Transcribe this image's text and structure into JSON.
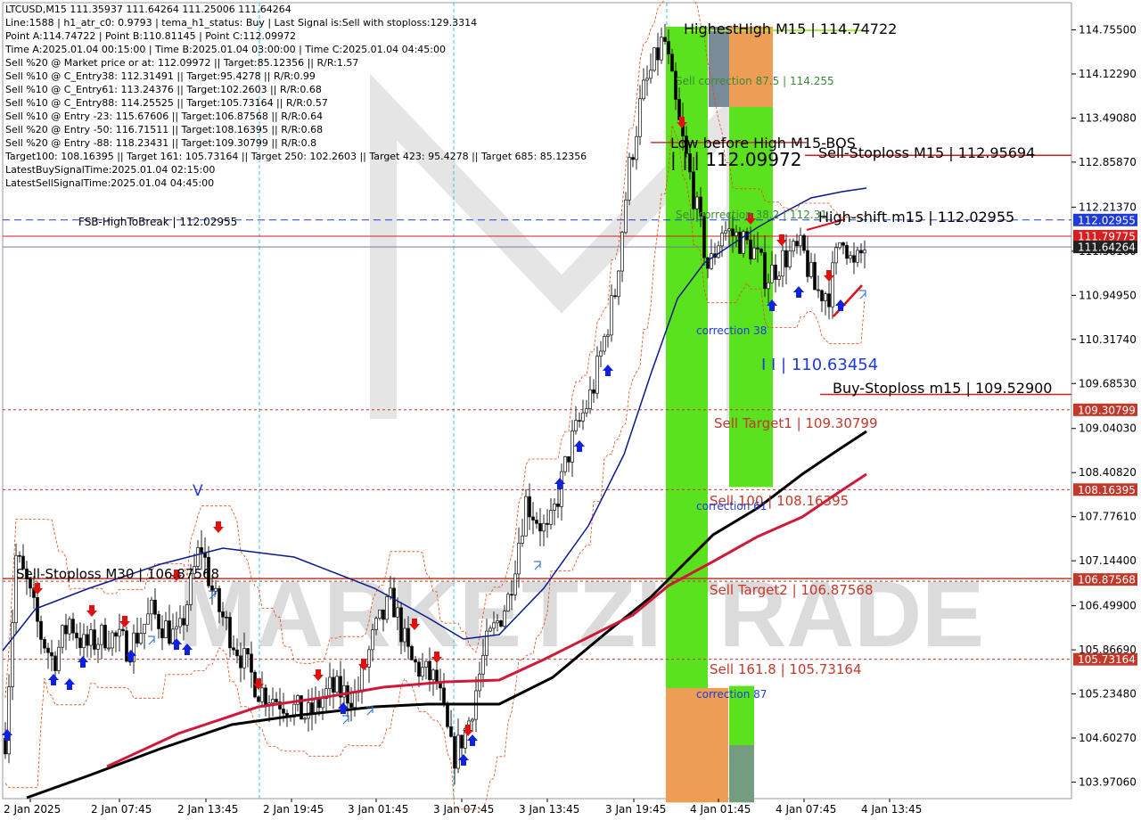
{
  "chart_data": {
    "type": "candlestick",
    "symbol": "LTCUSD,M15",
    "header": "LTCUSD,M15  111.35937 111.64264 111.25006 111.64264",
    "info_lines": [
      "Line:1588 | h1_atr_c0: 0.9793 | tema_h1_status: Buy | Last Signal is:Sell with stoploss:129.3314",
      "Point A:114.74722 | Point B:110.81145 | Point C:112.09972",
      "Time A:2025.01.04 00:15:00 | Time B:2025.01.04 03:00:00 | Time C:2025.01.04 04:45:00",
      "Sell %20 @ Market price or at: 112.09972 || Target:85.12356 || R/R:1.57",
      "Sell %10 @ C_Entry38: 112.31491 || Target:95.4278 || R/R:0.99",
      "Sell %10 @ C_Entry61: 113.24376 || Target:102.2603 || R/R:0.68",
      "Sell %10 @ C_Entry88: 114.25525 || Target:105.73164 || R/R:0.57",
      "Sell %10 @ Entry -23: 115.67606 || Target:106.87568 || R/R:0.64",
      "Sell %20 @ Entry -50: 116.71511 || Target:108.16395 || R/R:0.68",
      "Sell %20 @ Entry -88: 118.23431 || Target:109.30799 || R/R:0.8",
      "Target100: 108.16395 || Target 161: 105.73164 || Target 250: 102.2603 || Target 423: 95.4278 || Target 685: 85.12356",
      "LatestBuySignalTime:2025.01.04 02:15:00",
      "LatestSellSignalTime:2025.01.04 04:45:00"
    ],
    "y_ticks": [
      "114.75500",
      "114.12290",
      "113.49080",
      "112.85870",
      "112.21370",
      "111.58160",
      "110.94950",
      "110.31740",
      "109.68530",
      "109.04030",
      "108.40820",
      "107.77610",
      "107.14400",
      "106.49900",
      "105.86690",
      "105.23480",
      "104.60270",
      "103.97060"
    ],
    "x_ticks": [
      "2 Jan 2025",
      "2 Jan 07:45",
      "2 Jan 13:45",
      "2 Jan 19:45",
      "3 Jan 01:45",
      "3 Jan 07:45",
      "3 Jan 13:45",
      "3 Jan 19:45",
      "4 Jan 01:45",
      "4 Jan 07:45",
      "4 Jan 13:45"
    ],
    "ylim": [
      103.68,
      115.2
    ],
    "price_badges": [
      {
        "value": 112.02955,
        "label": "112.02955",
        "color": "#1f3bd6"
      },
      {
        "value": 111.79775,
        "label": "111.79775",
        "color": "#d61f1f"
      },
      {
        "value": 111.64264,
        "label": "111.64264",
        "color": "#222222"
      },
      {
        "value": 109.30799,
        "label": "109.30799",
        "color": "#c0392b"
      },
      {
        "value": 108.16395,
        "label": "108.16395",
        "color": "#c0392b"
      },
      {
        "value": 106.87568,
        "label": "106.87568",
        "color": "#c0392b"
      },
      {
        "value": 105.73164,
        "label": "105.73164",
        "color": "#c0392b"
      }
    ],
    "annotations": [
      {
        "text": "HighestHigh   M15 | 114.74722",
        "color": "#000000"
      },
      {
        "text": "Sell correction 87.5 | 114.255",
        "color": "#3a8a3a"
      },
      {
        "text": "Low before High   M15-BOS",
        "color": "#000000"
      },
      {
        "text": "| | | 112.09972",
        "color": "#000000"
      },
      {
        "text": "Sell-Stoploss M15 | 112.95694",
        "color": "#000000"
      },
      {
        "text": "Sell correction 38.2 | 112.31",
        "color": "#3a8a3a"
      },
      {
        "text": "High-shift m15 | 112.02955",
        "color": "#000000"
      },
      {
        "text": "FSB-HighToBreak | 112.02955",
        "color": "#000000"
      },
      {
        "text": "correction 38",
        "color": "#1f3bd6"
      },
      {
        "text": "I I | 110.63454",
        "color": "#1f3bd6"
      },
      {
        "text": "Buy-Stoploss m15 | 109.52900",
        "color": "#000000"
      },
      {
        "text": "Sell Target1 | 109.30799",
        "color": "#c0392b"
      },
      {
        "text": "Sell 100 | 108.16395",
        "color": "#c0392b"
      },
      {
        "text": "correction 61",
        "color": "#1f3bd6"
      },
      {
        "text": "Sell-Stoploss M30 | 106.87568",
        "color": "#000000"
      },
      {
        "text": "Sell Target2 | 106.87568",
        "color": "#c0392b"
      },
      {
        "text": "Sell 161.8 | 105.73164",
        "color": "#c0392b"
      },
      {
        "text": "correction 87",
        "color": "#1f3bd6"
      },
      {
        "text": "V",
        "color": "#1f3bd6"
      }
    ],
    "watermark": "MARKETZITRADE",
    "colors": {
      "sma_blue": "#0a1a8c",
      "sma_black": "#000000",
      "sma_red": "#d0183a",
      "bull": "#1a7a1a",
      "bear": "#000000",
      "band": "#e34a12",
      "zone_green": "#5be21f",
      "zone_orange": "#ee9d55",
      "zone_gray": "#7a8b98"
    }
  }
}
